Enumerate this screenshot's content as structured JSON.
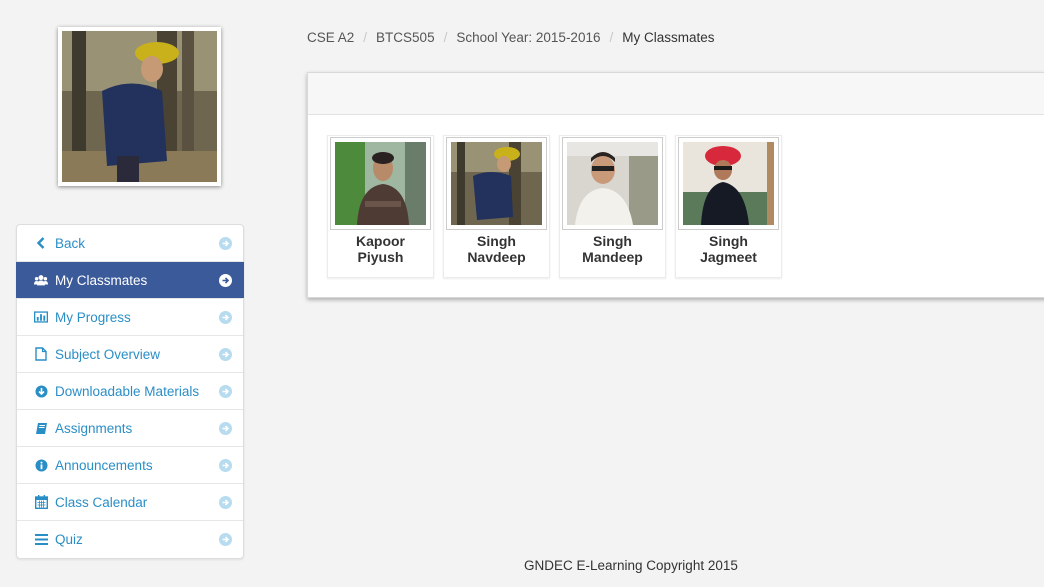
{
  "profile": {
    "photo_icon": "profile-photo"
  },
  "breadcrumb": {
    "items": [
      "CSE A2",
      "BTCS505",
      "School Year: 2015-2016"
    ],
    "current": "My Classmates"
  },
  "sidebar": {
    "items": [
      {
        "label": "Back",
        "icon": "chevron-left-icon"
      },
      {
        "label": "My Classmates",
        "icon": "users-icon",
        "active": true
      },
      {
        "label": "My Progress",
        "icon": "bar-chart-icon"
      },
      {
        "label": "Subject Overview",
        "icon": "file-icon"
      },
      {
        "label": "Downloadable Materials",
        "icon": "download-icon"
      },
      {
        "label": "Assignments",
        "icon": "book-icon"
      },
      {
        "label": "Announcements",
        "icon": "info-icon"
      },
      {
        "label": "Class Calendar",
        "icon": "calendar-icon"
      },
      {
        "label": "Quiz",
        "icon": "menu-icon"
      }
    ]
  },
  "classmates": [
    {
      "last": "Kapoor",
      "first": "Piyush"
    },
    {
      "last": "Singh",
      "first": "Navdeep"
    },
    {
      "last": "Singh",
      "first": "Mandeep"
    },
    {
      "last": "Singh",
      "first": "Jagmeet"
    }
  ],
  "colors": {
    "active_bg": "#3b5a9a",
    "link": "#2a8ec6",
    "arrow": "#b7dcef",
    "page_bg": "#f3f3f3"
  },
  "footer": {
    "text": "GNDEC E-Learning Copyright 2015"
  }
}
